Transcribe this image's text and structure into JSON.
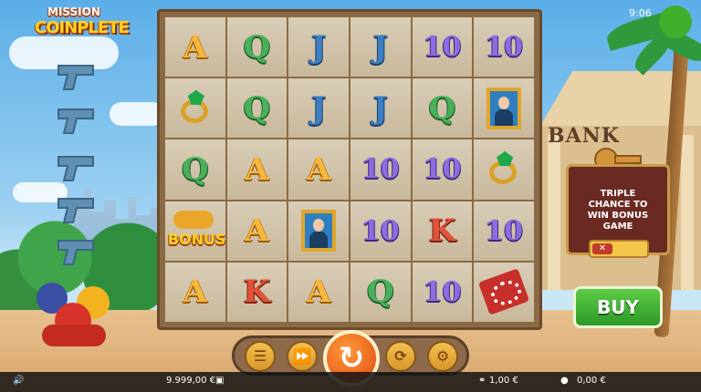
{
  "status_bar": {
    "time": "9:06"
  },
  "logo": {
    "line1": "MISSION",
    "line2": "COINPLETE"
  },
  "background": {
    "bank_sign": "BANK"
  },
  "grid": {
    "rows": [
      [
        "A",
        "Q",
        "J",
        "J",
        "10",
        "10"
      ],
      [
        "ring",
        "Q",
        "J",
        "J",
        "Q",
        "portrait"
      ],
      [
        "Q",
        "A",
        "A",
        "10",
        "10",
        "ring"
      ],
      [
        "bonus",
        "A",
        "portrait",
        "10",
        "K",
        "10"
      ],
      [
        "A",
        "K",
        "A",
        "Q",
        "10",
        "pearls"
      ]
    ],
    "bonus_label": "BONUS"
  },
  "side_panel": {
    "text_line1": "TRIPLE",
    "text_line2": "CHANCE TO",
    "text_line3": "WIN BONUS",
    "text_line4": "GAME",
    "toggle_icon": "x-icon"
  },
  "buy_button": {
    "label": "BUY"
  },
  "controls": {
    "menu": "menu-icon",
    "turbo": "fast-forward-icon",
    "spin": "spin-icon",
    "autoplay": "autoplay-icon",
    "bet": "coins-icon"
  },
  "footer": {
    "balance": "9.999,00 €",
    "bet": "1,00 €",
    "win": "0,00 €"
  },
  "colors": {
    "accent": "#f3c04d",
    "buy": "#3fb034",
    "spin": "#e04a13"
  }
}
